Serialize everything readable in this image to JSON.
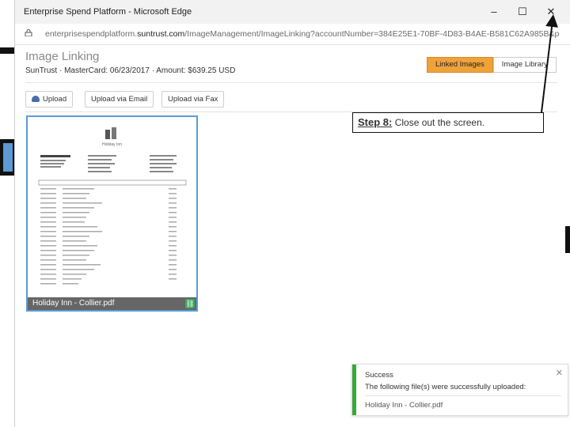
{
  "window": {
    "title": "Enterprise Spend Platform - Microsoft Edge",
    "minimize_glyph": "–",
    "maximize_glyph": "☐",
    "close_glyph": "✕"
  },
  "address": {
    "url_prefix": "enterprisespendplatform.",
    "url_domain": "suntrust.com",
    "url_path": "/ImageManagement/ImageLinking?accountNumber=384E25E1-70BF-4D83-B4AE-B581C62A985B&pendind"
  },
  "page": {
    "title": "Image Linking",
    "subinfo": "SunTrust · MasterCard: 06/23/2017 · Amount: $639.25 USD"
  },
  "tabs": [
    {
      "label": "Linked Images",
      "active": true
    },
    {
      "label": "Image Library",
      "active": false
    }
  ],
  "toolbar": {
    "upload_label": "Upload",
    "upload_email_label": "Upload via Email",
    "upload_fax_label": "Upload via Fax"
  },
  "thumbnail": {
    "filename": "Holiday Inn - Collier.pdf",
    "logo_text": "Holiday Inn"
  },
  "callout": {
    "step": "Step 8:",
    "text": "Close out the screen."
  },
  "toast": {
    "title": "Success",
    "message": "The following file(s) were successfully uploaded:",
    "file": "Holiday Inn - Collier.pdf",
    "close_glyph": "✕"
  },
  "colors": {
    "accent_tab": "#f0a23a",
    "thumb_border": "#5b9bd5",
    "success_bar": "#3aa835"
  }
}
